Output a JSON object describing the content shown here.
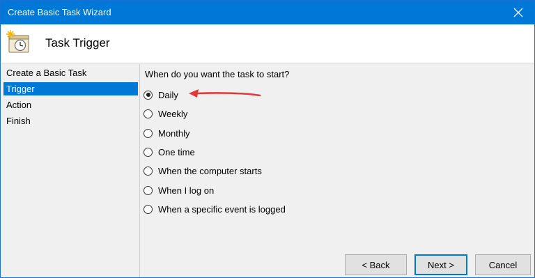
{
  "window": {
    "title": "Create Basic Task Wizard"
  },
  "header": {
    "title": "Task Trigger"
  },
  "steps": [
    {
      "label": "Create a Basic Task",
      "active": false
    },
    {
      "label": "Trigger",
      "active": true
    },
    {
      "label": "Action",
      "active": false
    },
    {
      "label": "Finish",
      "active": false
    }
  ],
  "trigger": {
    "question": "When do you want the task to start?",
    "selected": "Daily",
    "options": [
      "Daily",
      "Weekly",
      "Monthly",
      "One time",
      "When the computer starts",
      "When I log on",
      "When a specific event is logged"
    ]
  },
  "buttons": {
    "back": "< Back",
    "next": "Next >",
    "cancel": "Cancel"
  },
  "colors": {
    "accent": "#0078d7",
    "annotation_arrow": "#e03b3b"
  },
  "icons": {
    "close": "close-icon",
    "task": "scheduled-task-icon",
    "annotation": "red-arrow-annotation"
  }
}
